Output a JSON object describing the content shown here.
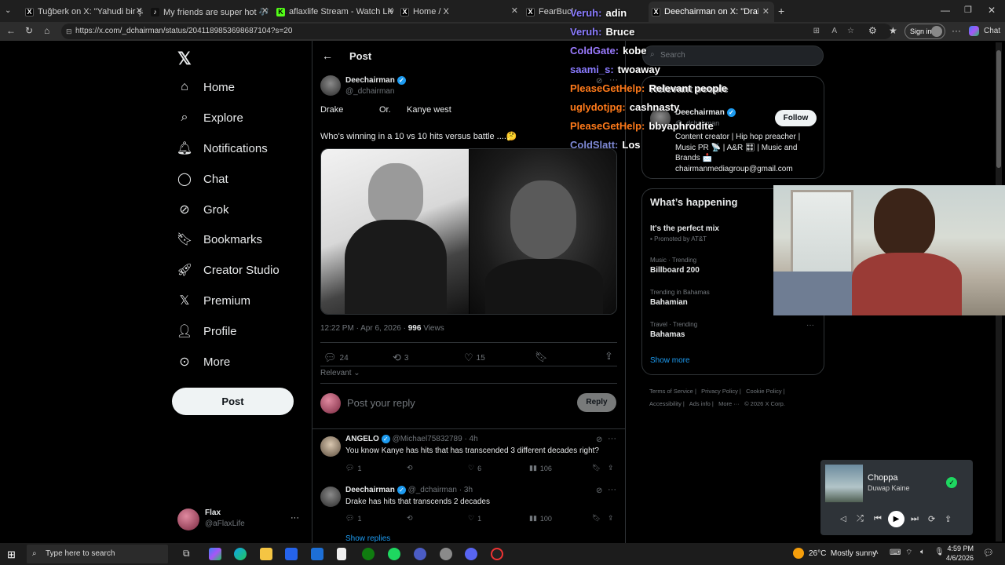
{
  "browser": {
    "tabs": [
      {
        "title": "Tuğberk on X: \"Yahudi bir şahıs, kı"
      },
      {
        "title": "My friends are super hot 🎶 😄 #j"
      },
      {
        "title": "aflaxlife Stream - Watch Live on Ki"
      },
      {
        "title": "Home / X"
      },
      {
        "title": "FearBuck on"
      },
      {
        "title": "Deechairman on X: \"Drake Or. Kan"
      }
    ],
    "url": "https://x.com/_dchairman/status/2041189853698687104?s=20",
    "sign_in": "Sign in",
    "chat": "Chat"
  },
  "sidebar": {
    "items": [
      {
        "label": "Home",
        "icon": "home-icon"
      },
      {
        "label": "Explore",
        "icon": "search-icon"
      },
      {
        "label": "Notifications",
        "icon": "bell-icon"
      },
      {
        "label": "Chat",
        "icon": "chat-bubble-icon"
      },
      {
        "label": "Grok",
        "icon": "grok-icon"
      },
      {
        "label": "Bookmarks",
        "icon": "bookmark-icon"
      },
      {
        "label": "Creator Studio",
        "icon": "rocket-icon"
      },
      {
        "label": "Premium",
        "icon": "x-logo-icon"
      },
      {
        "label": "Profile",
        "icon": "person-icon"
      },
      {
        "label": "More",
        "icon": "more-circle-icon"
      }
    ],
    "post_button": "Post",
    "account": {
      "name": "Flax",
      "handle": "@aFlaxLife",
      "menu": "···"
    }
  },
  "main": {
    "header_title": "Post",
    "post": {
      "author": "Deechairman",
      "handle": "@_dchairman",
      "option1": "Drake",
      "sep": "Or.",
      "option2": "Kanye west",
      "text": "Who's winning in a 10 vs 10 hits versus battle ....🤔",
      "timestamp": "12:22 PM · Apr 6, 2026 · ",
      "views_count": "996",
      "views_label": " Views",
      "replies": "24",
      "reposts": "3",
      "likes": "15"
    },
    "sort": "Relevant",
    "reply_placeholder": "Post your reply",
    "reply_button": "Reply",
    "replies": [
      {
        "author": "ANGELO",
        "handle": "@Michael75832789 · 4h",
        "text": "You know Kanye has hits that has transcended 3 different decades right?",
        "replies": "1",
        "reposts": "",
        "likes": "6",
        "views": "106"
      },
      {
        "author": "Deechairman",
        "handle": "@_dchairman · 3h",
        "text": "Drake has hits that transcends 2 decades",
        "replies": "1",
        "reposts": "",
        "likes": "1",
        "views": "100"
      }
    ],
    "show_replies": "Show replies"
  },
  "right": {
    "search_placeholder": "Search",
    "relevant_title": "Relevant people",
    "person": {
      "name": "Deechairman",
      "handle": "@_dchairman",
      "follow": "Follow",
      "bio": "Content creator | Hip hop preacher | Music PR 📡 | A&R 🎛 | Music and Brands 📩 chairmanmediagroup@gmail.com"
    },
    "happening_title": "What’s happening",
    "trends": [
      {
        "category": "",
        "name": "It's the perfect mix",
        "sub": "Promoted by AT&T"
      },
      {
        "category": "Music · Trending",
        "name": "Billboard 200",
        "sub": ""
      },
      {
        "category": "Trending in Bahamas",
        "name": "Bahamian",
        "sub": ""
      },
      {
        "category": "Travel · Trending",
        "name": "Bahamas",
        "sub": ""
      }
    ],
    "show_more": "Show more",
    "footer": [
      "Terms of Service",
      "Privacy Policy",
      "Cookie Policy",
      "Accessibility",
      "Ads info",
      "More ···",
      "© 2026 X Corp."
    ]
  },
  "stream_chat": [
    {
      "user": "Veruh:",
      "msg": "adin",
      "color": "#8a7bff"
    },
    {
      "user": "Veruh:",
      "msg": "Bruce",
      "color": "#8a7bff"
    },
    {
      "user": "ColdGate:",
      "msg": "kobe",
      "color": "#9b7bff"
    },
    {
      "user": "saami_s:",
      "msg": "twoaway",
      "color": "#8a7bff"
    },
    {
      "user": "PleaseGetHelp:",
      "msg": "Relevant people",
      "color": "#ff7a1a"
    },
    {
      "user": "uglydotjpg:",
      "msg": "cashnasty",
      "color": "#ff7a1a"
    },
    {
      "user": "PleaseGetHelp:",
      "msg": "bbyaphrodite",
      "color": "#ff7a1a"
    },
    {
      "user": "ColdSlatt:",
      "msg": "Los",
      "color": "#7f8ad6"
    }
  ],
  "player": {
    "title": "Choppa",
    "artist": "Duwap Kaine"
  },
  "taskbar": {
    "search_placeholder": "Type here to search",
    "weather": "26°C  Mostly sunny",
    "time": "4:59 PM",
    "date": "4/6/2026"
  }
}
